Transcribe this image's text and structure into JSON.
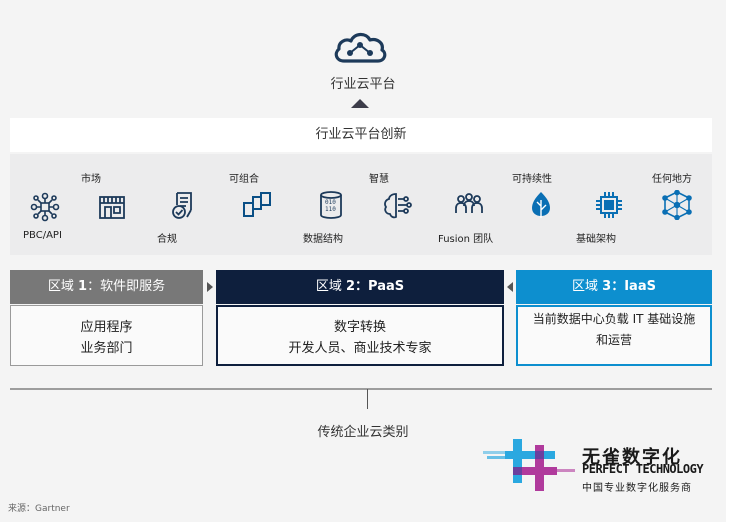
{
  "top": {
    "cloud_icon": "cloud-network-icon",
    "title": "行业云平台"
  },
  "innovation": {
    "title": "行业云平台创新"
  },
  "icons": [
    {
      "label": "PBC/API",
      "icon": "api-nodes-icon"
    },
    {
      "label": "市场",
      "icon": "storefront-icon"
    },
    {
      "label": "合规",
      "icon": "document-check-icon"
    },
    {
      "label": "可组合",
      "icon": "composable-blocks-icon"
    },
    {
      "label": "数据结构",
      "icon": "binary-data-icon"
    },
    {
      "label": "智慧",
      "icon": "brain-circuit-icon"
    },
    {
      "label": "Fusion 团队",
      "icon": "team-people-icon"
    },
    {
      "label": "可持续性",
      "icon": "leaf-icon"
    },
    {
      "label": "基础架构",
      "icon": "chip-icon"
    },
    {
      "label": "任何地方",
      "icon": "network-globe-icon"
    }
  ],
  "zones": [
    {
      "title_prefix": "区域 ",
      "title_num": "1",
      "title_rest": "：软件即服务",
      "line1": "应用程序",
      "line2": "业务部门",
      "color": "#787878"
    },
    {
      "title_prefix": "区域 ",
      "title_num": "2",
      "title_rest": "：PaaS",
      "line1": "数字转换",
      "line2": "开发人员、商业技术专家",
      "color": "#0e1f3d"
    },
    {
      "title_prefix": "区域 ",
      "title_num": "3",
      "title_rest": "：IaaS",
      "line1": "当前数据中心负载 IT 基础设施",
      "line2": "和运营",
      "color": "#0d8fcf"
    }
  ],
  "bottom": {
    "title": "传统企业云类别"
  },
  "source": "来源：Gartner",
  "logo": {
    "cn": "无雀数字化",
    "en": "PERFECT TECHNOLOGY",
    "sub": "中国专业数字化服务商"
  },
  "colors": {
    "icon_blue": "#0a6fb4",
    "icon_dark": "#1d3a5a",
    "accent_cyan": "#2aa8e0",
    "accent_magenta": "#b03a9c"
  }
}
